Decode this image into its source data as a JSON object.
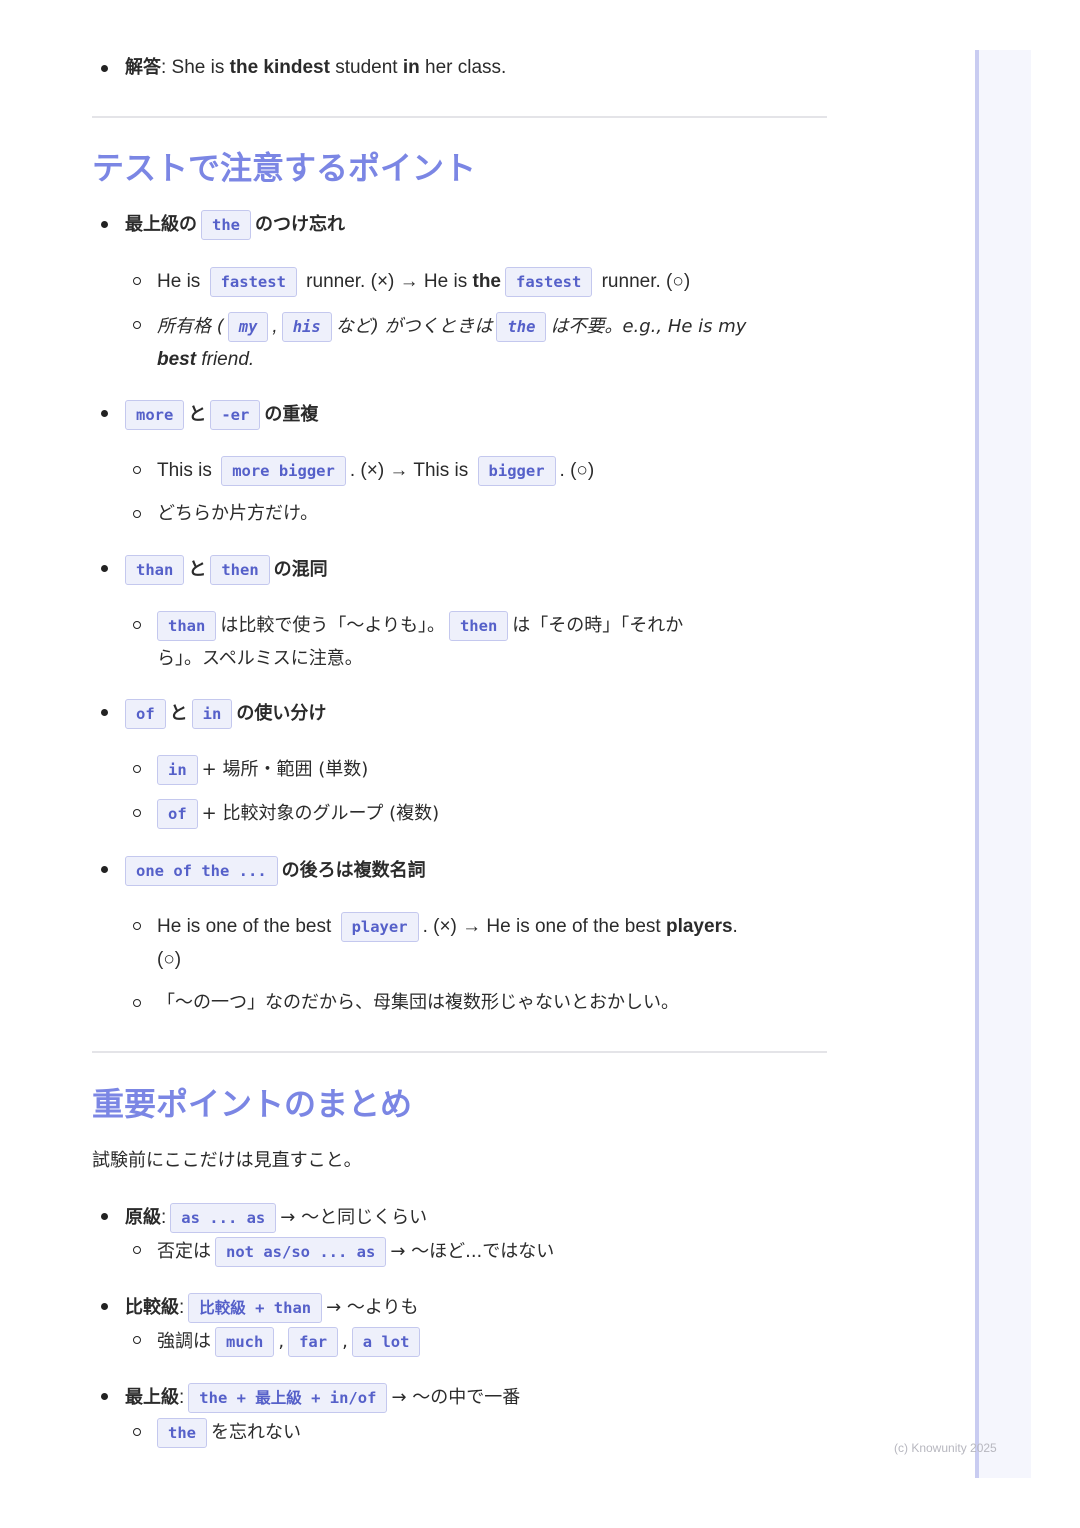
{
  "top": {
    "label": "解答",
    "pre": ": She is ",
    "b1": "the kindest",
    "mid": " student ",
    "b2": "in",
    "post": " her class."
  },
  "section1": {
    "title": "テストで注意するポイント",
    "items": [
      {
        "head": [
          "最上級の",
          "the",
          "のつけ忘れ"
        ],
        "sub1": [
          "He is ",
          "fastest",
          " runner. (×) → He is ",
          "the",
          "fastest",
          " runner. (○)"
        ],
        "sub2": [
          "所有格 (",
          "my",
          ",",
          "his",
          "など) がつくときは",
          "the",
          "は不要。e.g., He is my",
          "best",
          " friend."
        ]
      },
      {
        "head": [
          "more",
          "と",
          "-er",
          "の重複"
        ],
        "sub1": [
          "This is ",
          "more bigger",
          ". (×) → This is ",
          "bigger",
          ". (○)"
        ],
        "sub2": [
          "どちらか片方だけ。"
        ]
      },
      {
        "head": [
          "than",
          "と",
          "then",
          "の混同"
        ],
        "sub1": [
          "than",
          "は比較で使う「〜よりも」。",
          "then",
          "は「その時」「それか",
          "ら」。スペルミスに注意。"
        ]
      },
      {
        "head": [
          "of",
          "と",
          "in",
          "の使い分け"
        ],
        "sub1": [
          "in",
          "+ 場所・範囲 (単数)"
        ],
        "sub2": [
          "of",
          "+ 比較対象のグループ (複数)"
        ]
      },
      {
        "head": [
          "one of the ...",
          "の後ろは複数名詞"
        ],
        "sub1": [
          "He is one of the best ",
          "player",
          ". (×) → He is one of the best ",
          "players",
          ".",
          "(○)"
        ],
        "sub2": [
          "「〜の一つ」なのだから、母集団は複数形じゃないとおかしい。"
        ]
      }
    ]
  },
  "section2": {
    "title": "重要ポイントのまとめ",
    "intro": "試験前にここだけは見直すこと。",
    "items": [
      {
        "label": "原級",
        "code": "as ... as",
        "after": "→ 〜と同じくらい",
        "sub_pre": "否定は",
        "sub_code": "not as/so ... as",
        "sub_after": "→ 〜ほど...ではない"
      },
      {
        "label": "比較級",
        "code": "比較級 + than",
        "after": "→ 〜よりも",
        "sub_pre": "強調は",
        "sub_codes": [
          "much",
          "far",
          "a lot"
        ]
      },
      {
        "label": "最上級",
        "code": "the + 最上級 + in/of",
        "after": "→ 〜の中で一番",
        "sub_code": "the",
        "sub_after": "を忘れない"
      }
    ]
  },
  "footer": {
    "copyright": "(c) Knowunity 2025"
  },
  "colors": {
    "heading": "#7b86e4",
    "code_bg": "#eef0fb",
    "code_border": "#c4c8ee",
    "code_text": "#5560c9",
    "sidebar": "#f5f6fd"
  }
}
